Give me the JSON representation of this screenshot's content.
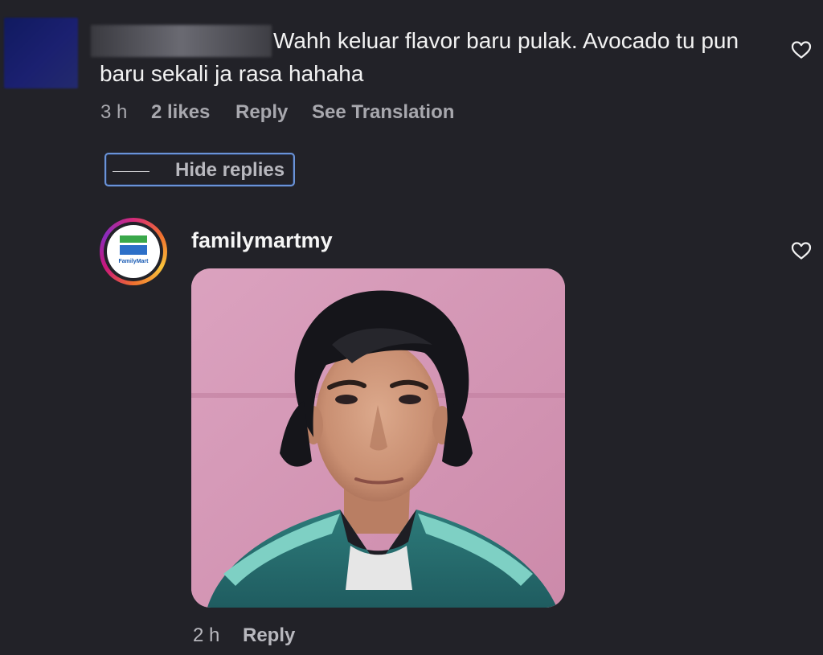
{
  "comment": {
    "text": "Wahh keluar flavor baru pulak. Avocado tu pun baru sekali ja rasa hahaha",
    "time": "3 h",
    "likes": "2 likes",
    "reply_label": "Reply",
    "translate_label": "See Translation"
  },
  "hide_replies_label": "Hide replies",
  "reply": {
    "username": "familymartmy",
    "avatar_text": "FamilyMart",
    "time": "2 h",
    "reply_label": "Reply"
  },
  "colors": {
    "background": "#222228",
    "focus_outline": "#6a93d8",
    "fm_green": "#3aa84a",
    "fm_blue": "#2c6fc8"
  },
  "icons": {
    "like": "heart-outline-icon"
  }
}
